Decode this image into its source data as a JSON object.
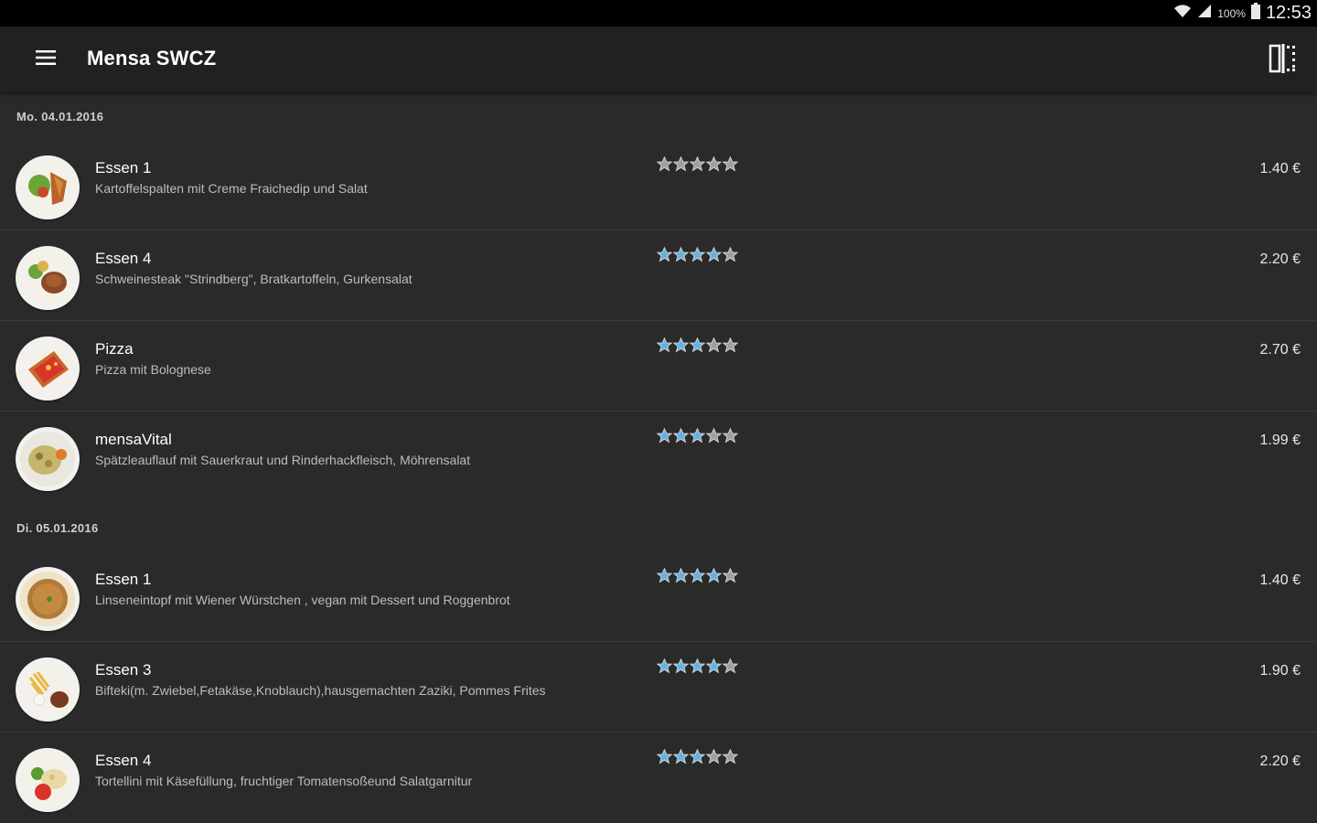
{
  "status_bar": {
    "battery_pct": "100%",
    "time": "12:53"
  },
  "toolbar": {
    "title": "Mensa SWCZ"
  },
  "colors": {
    "star_filled": "#5fb2e6",
    "star_empty": "#9e9e9e",
    "toolbar": "#212121",
    "background": "#2a2a2a"
  },
  "days": [
    {
      "label": "Mo. 04.01.2016",
      "meals": [
        {
          "name": "Essen 1",
          "description": "Kartoffelspalten mit Creme Fraichedip und Salat",
          "price": "1.40 €",
          "rating": 0,
          "icon": "food-potato-wedges-salad"
        },
        {
          "name": "Essen 4",
          "description": "Schweinesteak \"Strindberg\", Bratkartoffeln, Gurkensalat",
          "price": "2.20 €",
          "rating": 4,
          "icon": "food-pork-steak"
        },
        {
          "name": "Pizza",
          "description": "Pizza mit Bolognese",
          "price": "2.70 €",
          "rating": 3,
          "icon": "food-pizza"
        },
        {
          "name": "mensaVital",
          "description": "Spätzleauflauf mit Sauerkraut und Rinderhackfleisch, Möhrensalat",
          "price": "1.99 €",
          "rating": 3,
          "icon": "food-spaetzle-casserole"
        }
      ]
    },
    {
      "label": "Di. 05.01.2016",
      "meals": [
        {
          "name": "Essen 1",
          "description": "Linseneintopf mit Wiener Würstchen , vegan mit Dessert und Roggenbrot",
          "price": "1.40 €",
          "rating": 4,
          "icon": "food-lentil-stew"
        },
        {
          "name": "Essen 3",
          "description": "Bifteki(m. Zwiebel,Fetakäse,Knoblauch),hausgemachten Zaziki, Pommes Frites",
          "price": "1.90 €",
          "rating": 4,
          "icon": "food-bifteki-fries"
        },
        {
          "name": "Essen 4",
          "description": "Tortellini mit Käsefüllung, fruchtiger Tomatensoßeund Salatgarnitur",
          "price": "2.20 €",
          "rating": 3,
          "icon": "food-tortellini"
        }
      ]
    }
  ]
}
